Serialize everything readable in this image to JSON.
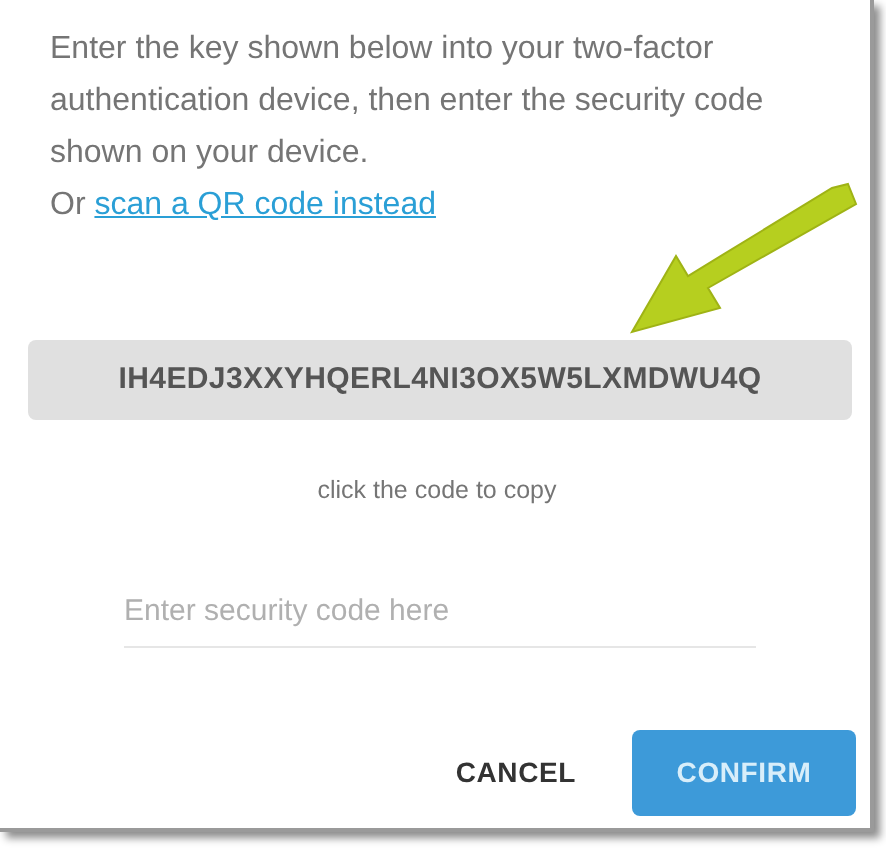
{
  "dialog": {
    "instructions": "Enter the key shown below into your two-factor authentication device, then enter the security code shown on your device.",
    "link_prefix": "Or",
    "link": "scan a QR code instead",
    "key": "IH4EDJ3XXYHQERL4NI3OX5W5LXMDWU4Q",
    "key_hint": "click the code to copy",
    "code_field": {
      "placeholder": "Enter security code here"
    },
    "buttons": [
      {
        "label": "CANCEL",
        "kind": "text"
      },
      {
        "label": "CONFIRM",
        "kind": "primary"
      }
    ]
  }
}
